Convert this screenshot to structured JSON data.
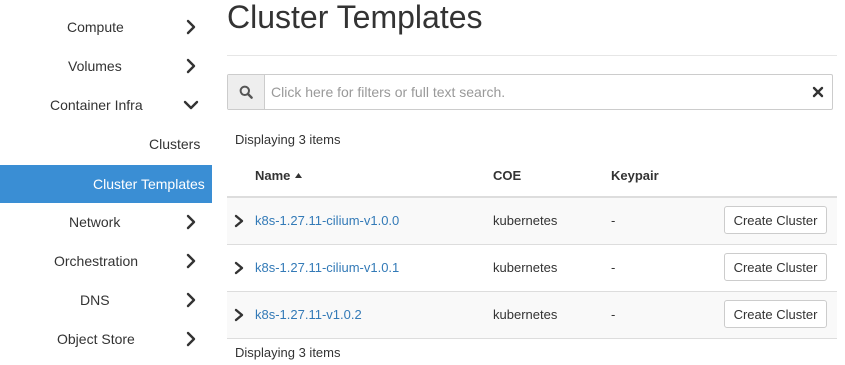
{
  "sidebar": {
    "items": [
      {
        "label": "Compute"
      },
      {
        "label": "Volumes"
      },
      {
        "label": "Container Infra"
      },
      {
        "label": "Clusters"
      },
      {
        "label": "Cluster Templates"
      },
      {
        "label": "Network"
      },
      {
        "label": "Orchestration"
      },
      {
        "label": "DNS"
      },
      {
        "label": "Object Store"
      }
    ],
    "active_item": "Cluster Templates",
    "active_color": "#3a8ed4"
  },
  "main": {
    "title": "Cluster Templates",
    "search": {
      "placeholder": "Click here for filters or full text search.",
      "icon": "search-icon",
      "clear_icon": "close-icon"
    },
    "count_top": "Displaying 3 items",
    "count_bottom": "Displaying 3 items",
    "table": {
      "columns": [
        "Name",
        "COE",
        "Keypair"
      ],
      "sort_column": "Name",
      "sort_direction": "ascending",
      "rows": [
        {
          "name": "k8s-1.27.11-cilium-v1.0.0",
          "coe": "kubernetes",
          "keypair": "-",
          "action": "Create Cluster"
        },
        {
          "name": "k8s-1.27.11-cilium-v1.0.1",
          "coe": "kubernetes",
          "keypair": "-",
          "action": "Create Cluster"
        },
        {
          "name": "k8s-1.27.11-v1.0.2",
          "coe": "kubernetes",
          "keypair": "-",
          "action": "Create Cluster"
        }
      ]
    },
    "link_color": "#337ab7"
  }
}
